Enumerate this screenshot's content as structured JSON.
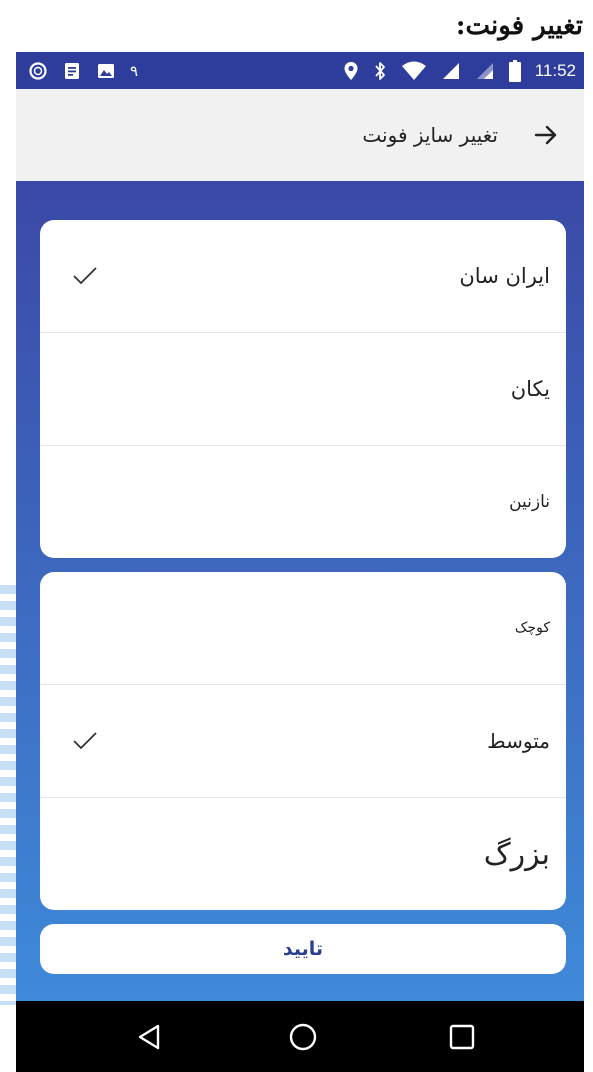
{
  "caption": "تغییر فونت:",
  "status_bar": {
    "time": "11:52",
    "notification_digit": "۹",
    "icons_left": [
      "circle-icon",
      "doc-icon",
      "image-icon"
    ],
    "icons_right": [
      "location-icon",
      "bluetooth-icon",
      "wifi-icon",
      "signal-icon",
      "signal-icon-2",
      "battery-icon"
    ]
  },
  "toolbar": {
    "title": "تغییر سایز فونت"
  },
  "font_list": {
    "items": [
      {
        "label": "ایران سان",
        "checked": true
      },
      {
        "label": "یکان",
        "checked": false
      },
      {
        "label": "نازنین",
        "checked": false
      }
    ]
  },
  "size_list": {
    "items": [
      {
        "label": "کوچک",
        "checked": false
      },
      {
        "label": "متوسط",
        "checked": true
      },
      {
        "label": "بزرگ",
        "checked": false
      }
    ]
  },
  "confirm_label": "تایید",
  "colors": {
    "status_bar": "#2e3c9c",
    "gradient_top": "#3b49a6",
    "gradient_bottom": "#3f8ad9",
    "confirm_text": "#2a3f8f"
  }
}
